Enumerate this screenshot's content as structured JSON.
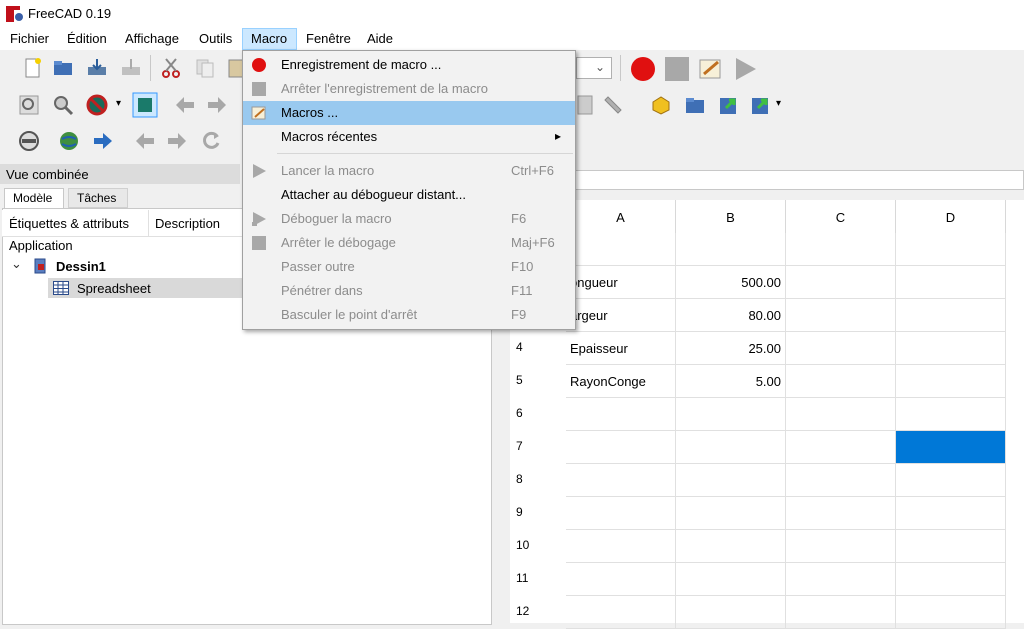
{
  "window": {
    "title": "FreeCAD 0.19"
  },
  "menubar": [
    "Fichier",
    "Édition",
    "Affichage",
    "Outils",
    "Macro",
    "Fenêtre",
    "Aide"
  ],
  "macro_menu": {
    "items": [
      {
        "label": "Enregistrement de macro ...",
        "shortcut": "",
        "enabled": true
      },
      {
        "label": "Arrêter l'enregistrement de la macro",
        "shortcut": "",
        "enabled": false
      },
      {
        "label": "Macros ...",
        "shortcut": "",
        "enabled": true,
        "highlighted": true
      },
      {
        "label": "Macros récentes",
        "shortcut": "",
        "enabled": true,
        "submenu_arrow": "▸"
      },
      {
        "label": "Lancer la macro",
        "shortcut": "Ctrl+F6",
        "enabled": false
      },
      {
        "label": "Attacher au débogueur distant...",
        "shortcut": "",
        "enabled": true
      },
      {
        "label": "Déboguer la macro",
        "shortcut": "F6",
        "enabled": false
      },
      {
        "label": "Arrêter le débogage",
        "shortcut": "Maj+F6",
        "enabled": false
      },
      {
        "label": "Passer outre",
        "shortcut": "F10",
        "enabled": false
      },
      {
        "label": "Pénétrer dans",
        "shortcut": "F11",
        "enabled": false
      },
      {
        "label": "Basculer le point d'arrêt",
        "shortcut": "F9",
        "enabled": false
      }
    ]
  },
  "combo_view": {
    "title": "Vue combinée",
    "tabs": [
      "Modèle",
      "Tâches"
    ],
    "columns": [
      "Étiquettes & attributs",
      "Description"
    ],
    "tree": {
      "root": "Application",
      "document": "Dessin1",
      "child": "Spreadsheet",
      "expand_glyph": "⌄"
    }
  },
  "spreadsheet": {
    "columns": [
      "A",
      "B",
      "C",
      "D"
    ],
    "rows": [
      {
        "num": "4",
        "a": "Epaisseur",
        "b": "25.00"
      },
      {
        "num": "5",
        "a": "RayonConge",
        "b": "5.00"
      },
      {
        "num": "6",
        "a": "",
        "b": ""
      },
      {
        "num": "7",
        "a": "",
        "b": ""
      },
      {
        "num": "8",
        "a": "",
        "b": ""
      },
      {
        "num": "9",
        "a": "",
        "b": ""
      },
      {
        "num": "10",
        "a": "",
        "b": ""
      },
      {
        "num": "11",
        "a": "",
        "b": ""
      },
      {
        "num": "12",
        "a": "",
        "b": ""
      }
    ],
    "partial_rows": [
      {
        "a": "ongueur",
        "b": "500.00"
      },
      {
        "a": "argeur",
        "b": "80.00"
      }
    ],
    "selected_color": "#0078d7"
  },
  "colors": {
    "menu_highlight": "#99c9ef",
    "record": "#e01010"
  }
}
